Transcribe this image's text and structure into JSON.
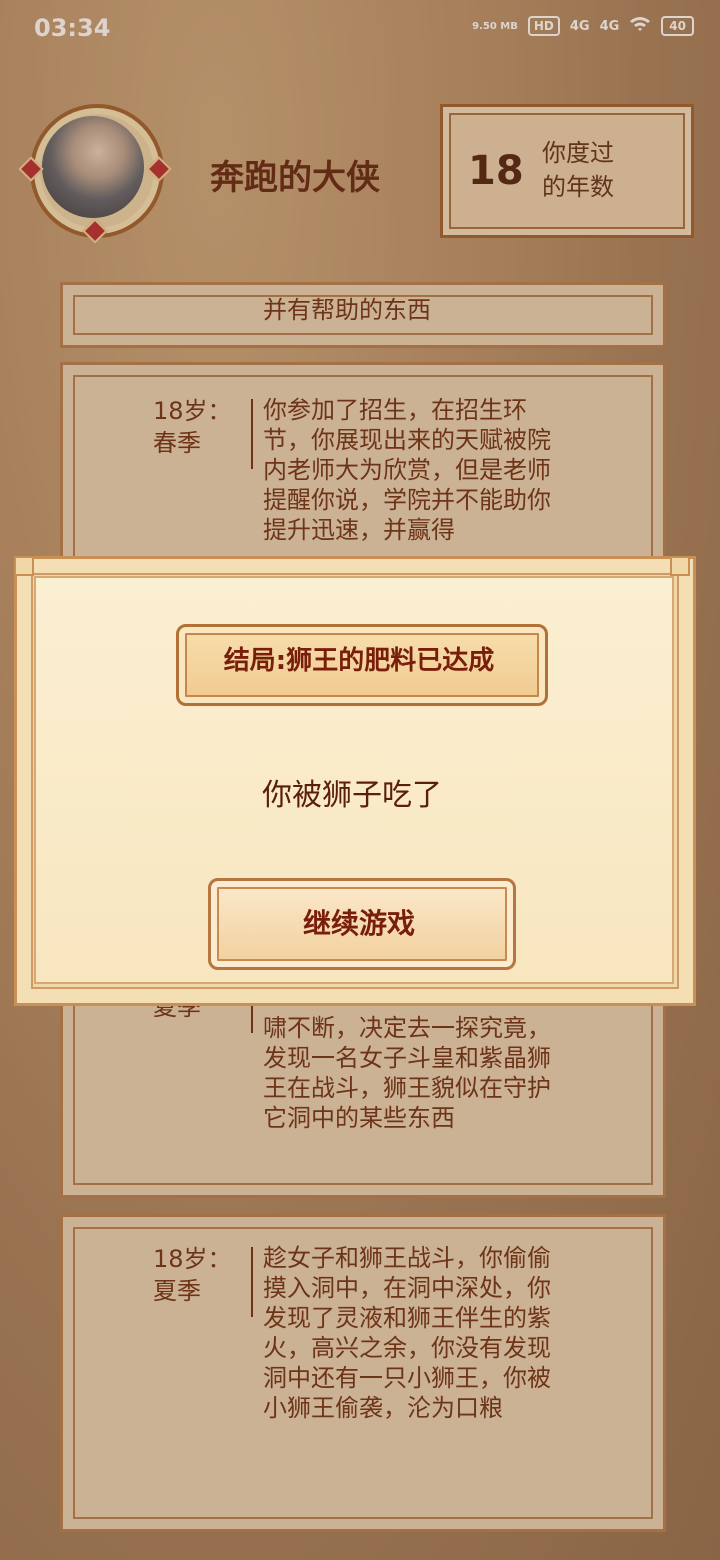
{
  "status_bar": {
    "time": "03:34",
    "net_speed": "9.50 MB",
    "hd": "HD",
    "signal1": "4G",
    "signal2": "4G",
    "battery": "40"
  },
  "header": {
    "player_name": "奔跑的大侠",
    "years_value": "18",
    "years_label_line1": "你度过",
    "years_label_line2": "的年数"
  },
  "events": [
    {
      "age_line1": "",
      "age_line2": "",
      "text": "并有帮助的东西"
    },
    {
      "age_line1": "18岁：",
      "age_line2": "春季",
      "text": "你参加了招生，在招生环节，你展现出来的天赋被院内老师大为欣赏，但是老师提醒你说，学院并不能助你提升迅速，并赢得"
    },
    {
      "age_line1": "",
      "age_line2": "夏季",
      "text": "啸不断，决定去一探究竟，发现一名女子斗皇和紫晶狮王在战斗，狮王貌似在守护它洞中的某些东西"
    },
    {
      "age_line1": "18岁：",
      "age_line2": "夏季",
      "text": "趁女子和狮王战斗，你偷偷摸入洞中，在洞中深处，你发现了灵液和狮王伴生的紫火，高兴之余，你没有发现洞中还有一只小狮王，你被小狮王偷袭，沦为口粮"
    }
  ],
  "modal": {
    "result_title": "结局:狮王的肥料已达成",
    "message": "你被狮子吃了",
    "continue_label": "继续游戏"
  }
}
